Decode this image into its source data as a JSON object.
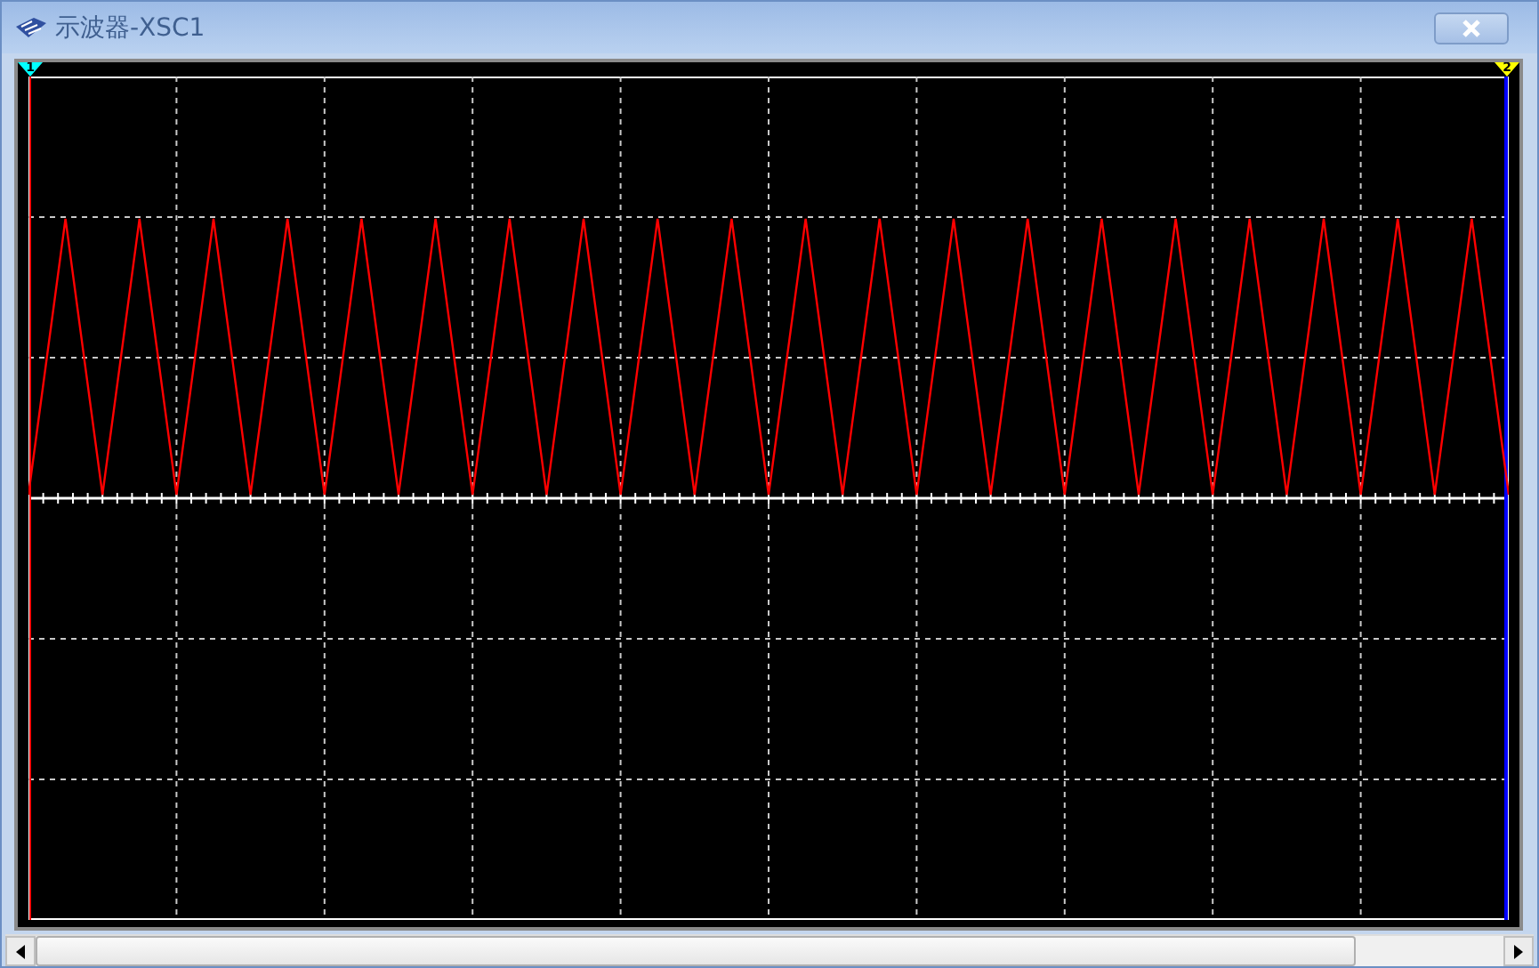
{
  "window": {
    "title": "示波器-XSC1"
  },
  "cursors": [
    {
      "label": "1",
      "color": "#00ffff"
    },
    {
      "label": "2",
      "color": "#ffff00"
    }
  ]
}
